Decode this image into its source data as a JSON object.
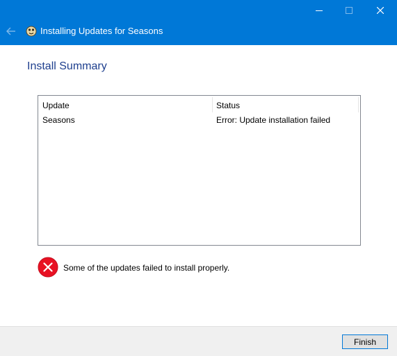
{
  "window": {
    "title": "Installing Updates for Seasons",
    "controls": [
      "minimize-icon",
      "maximize-icon",
      "close-icon"
    ],
    "accent_color": "#0078d7"
  },
  "page": {
    "heading": "Install Summary"
  },
  "updates_table": {
    "columns": [
      "Update",
      "Status"
    ],
    "rows": [
      {
        "update": "Seasons",
        "status": "Error: Update installation failed"
      }
    ]
  },
  "result": {
    "icon": "error-icon",
    "message": "Some of the updates failed to install properly."
  },
  "footer": {
    "finish_label": "Finish"
  }
}
